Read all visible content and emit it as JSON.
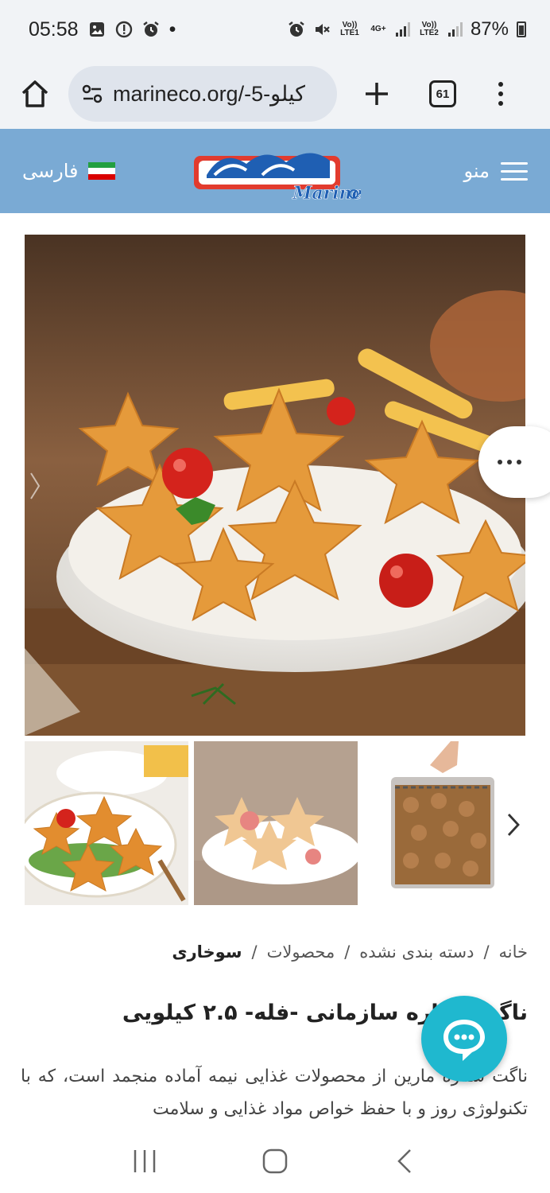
{
  "status_bar": {
    "time": "05:58",
    "dot": "•",
    "volte1": "Vo)) LTE1",
    "network": "4G+",
    "volte2": "Vo)) LTE2",
    "battery": "87%"
  },
  "browser": {
    "url": "marineco.org/-5-کیلو",
    "tab_count": "61"
  },
  "header": {
    "language": "فارسی",
    "menu_label": "منو",
    "logo_text": "مارین Marine"
  },
  "breadcrumb": {
    "items": [
      "خانه",
      "دسته بندی نشده",
      "محصولات",
      "سوخاری"
    ],
    "separator": "/"
  },
  "product": {
    "title": "ناگت ستاره سازمانی -فله- ۲.۵ کیلویی",
    "description": "ناگت ستاره مارین از محصولات غذایی نیمه آماده منجمد است، که با تکنولوژی روز و با حفظ خواص مواد غذایی و سلامت"
  },
  "colors": {
    "header_bg": "#7aaad4",
    "chat_button": "#1fb8cf",
    "browser_bg": "#f1f3f6"
  }
}
